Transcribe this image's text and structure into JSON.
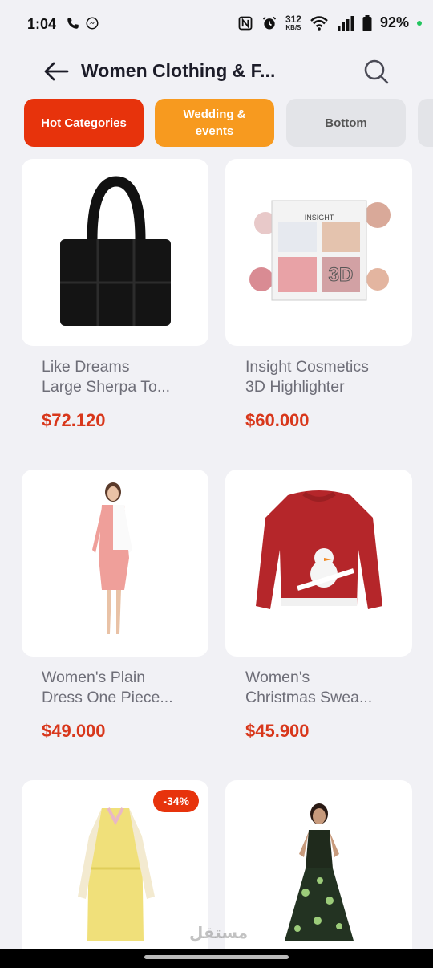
{
  "status_bar": {
    "time": "1:04",
    "net_speed": "312",
    "net_unit": "KB/S",
    "battery": "92%",
    "icons": [
      "phone-icon",
      "messenger-icon",
      "nfc-icon",
      "alarm-icon",
      "wifi-icon",
      "signal-icon",
      "battery-icon"
    ]
  },
  "header": {
    "title": "Women Clothing & F...",
    "back_icon": "arrow-left-icon",
    "search_icon": "search-icon"
  },
  "chips": [
    {
      "label": "Hot Categories",
      "color": "#e7330c"
    },
    {
      "label": "Wedding & events",
      "color": "#f79a1f"
    },
    {
      "label": "Bottom",
      "color": "#e3e4e8"
    },
    {
      "label": ""
    }
  ],
  "products": [
    {
      "line1": "Like Dreams",
      "line2": "Large Sherpa To...",
      "price": "$72.120",
      "image": "tote-bag"
    },
    {
      "line1": "Insight Cosmetics",
      "line2": "3D Highlighter",
      "price": "$60.000",
      "image": "highlighter-palette",
      "palette_brand": "INSIGHT",
      "palette_label": "3D"
    },
    {
      "line1": "Women's Plain",
      "line2": "Dress One Piece...",
      "price": "$49.000",
      "image": "pink-dress"
    },
    {
      "line1": "Women's",
      "line2": "Christmas Swea...",
      "price": "$45.900",
      "image": "christmas-sweater"
    },
    {
      "line1": "",
      "line2": "",
      "price": "",
      "image": "yellow-dress",
      "badge": "-34%"
    },
    {
      "line1": "",
      "line2": "",
      "price": "",
      "image": "green-gown"
    }
  ],
  "watermark": "مستقل",
  "colors": {
    "accent": "#e7330c",
    "price": "#d8371b",
    "secondary": "#f79a1f"
  }
}
